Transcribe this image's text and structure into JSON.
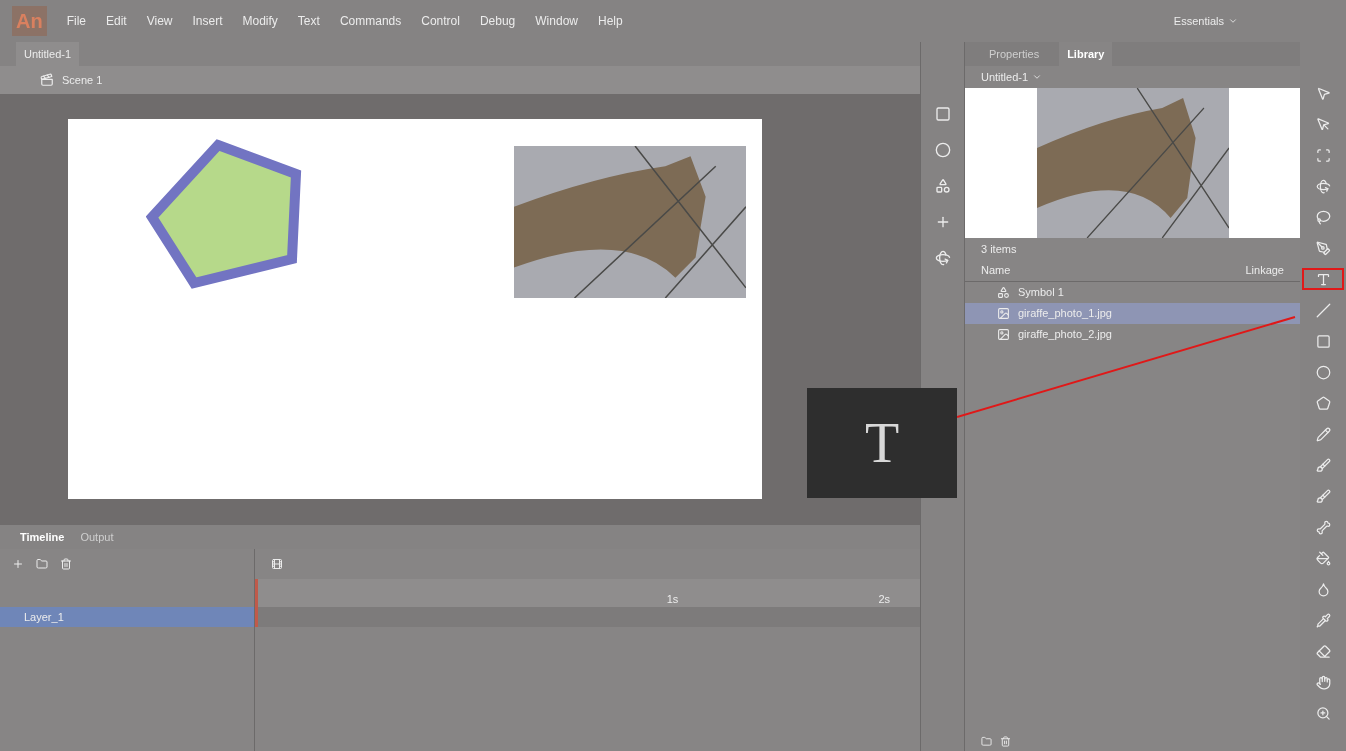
{
  "app": {
    "logo": "An",
    "workspace": "Essentials"
  },
  "menu": [
    "File",
    "Edit",
    "View",
    "Insert",
    "Modify",
    "Text",
    "Commands",
    "Control",
    "Debug",
    "Window",
    "Help"
  ],
  "document": {
    "tab": "Untitled-1",
    "scene": "Scene 1"
  },
  "panel": {
    "tabs": [
      {
        "label": "Properties",
        "selected": false
      },
      {
        "label": "Library",
        "selected": true
      }
    ],
    "library_name": "Untitled-1",
    "item_count": "3 items",
    "columns": [
      "Name",
      "Linkage"
    ],
    "items": [
      {
        "kind": "symbol",
        "name": "Symbol 1",
        "selected": false
      },
      {
        "kind": "bitmap",
        "name": "giraffe_photo_1.jpg",
        "selected": true
      },
      {
        "kind": "bitmap",
        "name": "giraffe_photo_2.jpg",
        "selected": false
      }
    ]
  },
  "timeline": {
    "tabs": [
      {
        "label": "Timeline",
        "selected": true
      },
      {
        "label": "Output",
        "selected": false
      }
    ],
    "ruler": [
      "1s",
      "2s"
    ],
    "layers": [
      {
        "name": "Layer_1",
        "selected": true
      }
    ]
  },
  "tools": [
    {
      "kind": "selection",
      "selected": false
    },
    {
      "kind": "subselection",
      "selected": false
    },
    {
      "kind": "transform",
      "selected": false
    },
    {
      "kind": "rotate",
      "selected": false
    },
    {
      "kind": "lasso",
      "selected": false
    },
    {
      "kind": "pen",
      "selected": false
    },
    {
      "kind": "text",
      "selected": true
    },
    {
      "kind": "line",
      "selected": false
    },
    {
      "kind": "rectangle",
      "selected": false
    },
    {
      "kind": "oval",
      "selected": false
    },
    {
      "kind": "polystar",
      "selected": false
    },
    {
      "kind": "pencil",
      "selected": false
    },
    {
      "kind": "brush",
      "selected": false
    },
    {
      "kind": "brush",
      "selected": false
    },
    {
      "kind": "bone",
      "selected": false
    },
    {
      "kind": "bucket",
      "selected": false
    },
    {
      "kind": "ink",
      "selected": false
    },
    {
      "kind": "eyedropper",
      "selected": false
    },
    {
      "kind": "eraser",
      "selected": false
    },
    {
      "kind": "hand",
      "selected": false
    },
    {
      "kind": "zoom",
      "selected": false
    }
  ],
  "callout": {
    "glyph": "T"
  }
}
